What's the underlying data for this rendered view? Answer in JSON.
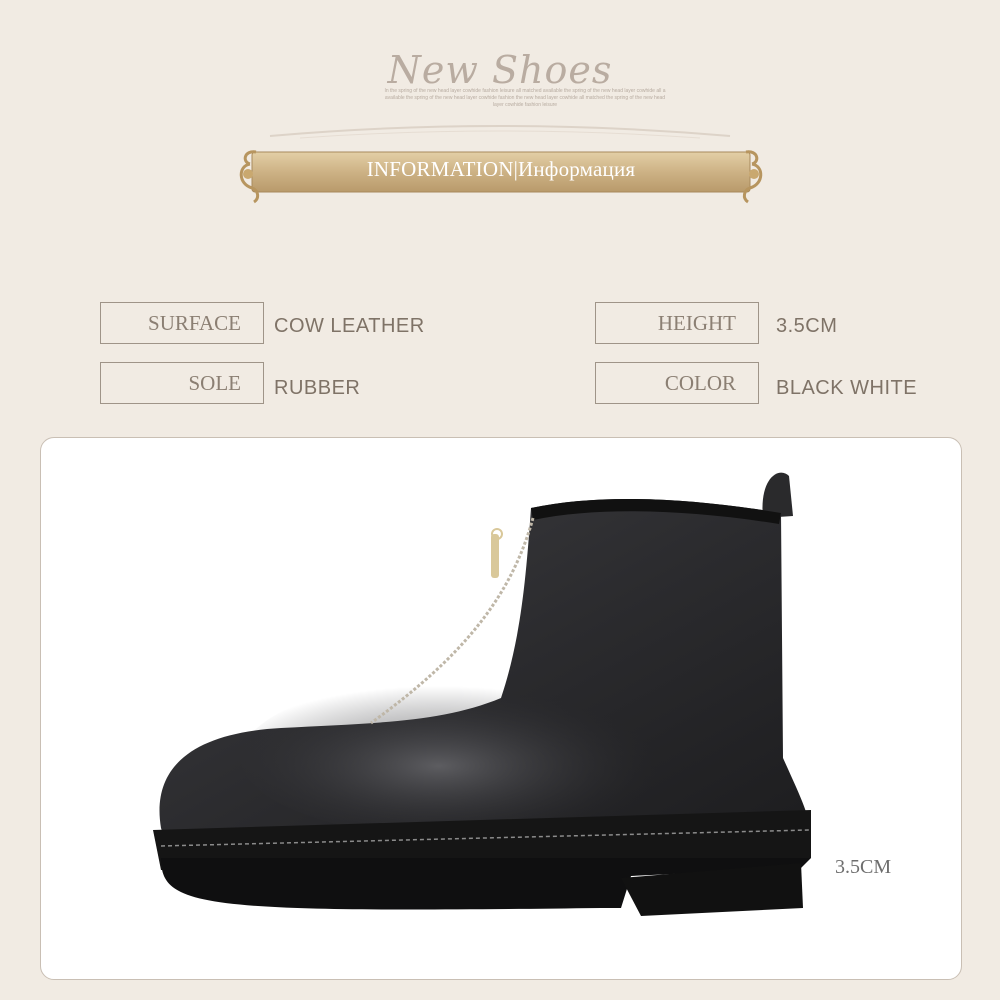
{
  "brand": {
    "title": "New Shoes",
    "tagline": "In the spring of the new head layer cowhide fashion leisure all matched available the spring of the new head layer cowhide all a available the spring of the new head layer cowhide fashion the new head layer cowhide all matched the spring of the new head layer cowhide fashion leisure"
  },
  "banner": {
    "text": "INFORMATION|Информация"
  },
  "specs": [
    {
      "label": "SURFACE",
      "value": "COW LEATHER"
    },
    {
      "label": "HEIGHT",
      "value": "3.5CM"
    },
    {
      "label": "SOLE",
      "value": "RUBBER"
    },
    {
      "label": "COLOR",
      "value": "BLACK WHITE"
    }
  ],
  "photo": {
    "heel_height_caption": "3.5CM"
  },
  "colors": {
    "background": "#f1ebe3",
    "banner_gold": "#d2b98c",
    "label_border": "#9f9488",
    "text": "#8b7f73"
  }
}
